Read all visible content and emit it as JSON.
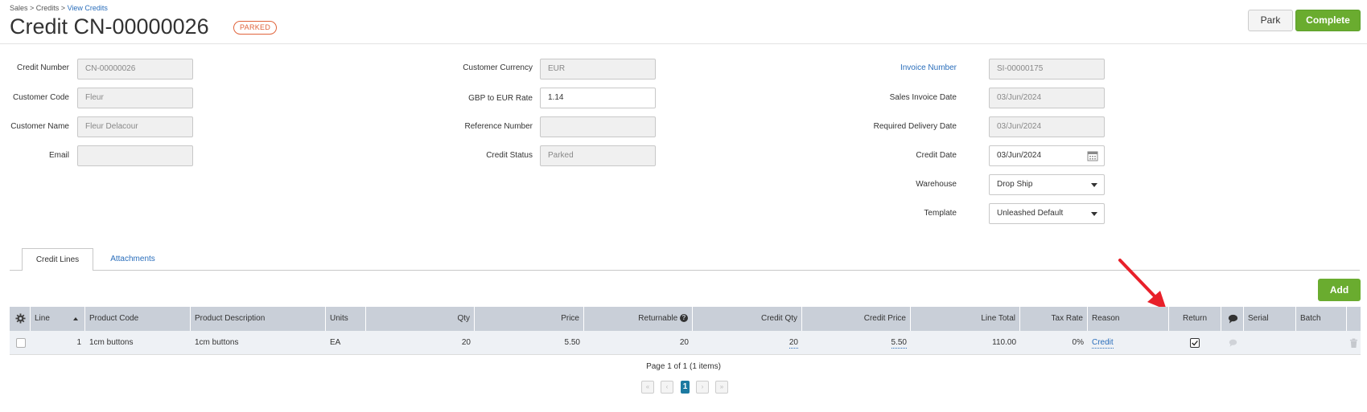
{
  "breadcrumb": {
    "part1": "Sales",
    "sep1": " > ",
    "part2": "Credits",
    "sep2": " > ",
    "part3": "View Credits"
  },
  "header": {
    "title": "Credit CN-00000026",
    "status_badge": "PARKED",
    "park_label": "Park",
    "complete_label": "Complete"
  },
  "form": {
    "credit_number": {
      "label": "Credit Number",
      "value": "CN-00000026"
    },
    "customer_code": {
      "label": "Customer Code",
      "value": "Fleur"
    },
    "customer_name": {
      "label": "Customer Name",
      "value": "Fleur Delacour"
    },
    "email": {
      "label": "Email",
      "value": ""
    },
    "customer_currency": {
      "label": "Customer Currency",
      "value": "EUR"
    },
    "exchange_rate": {
      "label": "GBP to EUR Rate",
      "value": "1.14"
    },
    "reference_number": {
      "label": "Reference Number",
      "value": ""
    },
    "credit_status": {
      "label": "Credit Status",
      "value": "Parked"
    },
    "invoice_number": {
      "label": "Invoice Number",
      "value": "SI-00000175"
    },
    "sales_invoice_date": {
      "label": "Sales Invoice Date",
      "value": "03/Jun/2024"
    },
    "required_delivery_date": {
      "label": "Required Delivery Date",
      "value": "03/Jun/2024"
    },
    "credit_date": {
      "label": "Credit Date",
      "value": "03/Jun/2024"
    },
    "warehouse": {
      "label": "Warehouse",
      "value": "Drop Ship"
    },
    "template": {
      "label": "Template",
      "value": "Unleashed Default"
    }
  },
  "tabs": [
    {
      "label": "Credit Lines"
    },
    {
      "label": "Attachments"
    }
  ],
  "add_label": "Add",
  "table": {
    "headers": {
      "line": "Line",
      "product_code": "Product Code",
      "product_description": "Product Description",
      "units": "Units",
      "qty": "Qty",
      "price": "Price",
      "returnable": "Returnable",
      "credit_qty": "Credit Qty",
      "credit_price": "Credit Price",
      "line_total": "Line Total",
      "tax_rate": "Tax Rate",
      "reason": "Reason",
      "return": "Return",
      "serial": "Serial",
      "batch": "Batch"
    },
    "rows": [
      {
        "line": "1",
        "product_code": "1cm buttons",
        "product_description": "1cm buttons",
        "units": "EA",
        "qty": "20",
        "price": "5.50",
        "returnable": "20",
        "credit_qty": "20",
        "credit_price": "5.50",
        "line_total": "110.00",
        "tax_rate": "0%",
        "reason": "Credit",
        "return_checked": true,
        "serial": "",
        "batch": ""
      }
    ]
  },
  "pager": {
    "summary": "Page 1 of 1 (1 items)",
    "current_page": "1"
  },
  "colors": {
    "accent_green": "#6aac2f",
    "link_blue": "#2a6ebb",
    "badge_orange": "#e0643c",
    "annotation_red": "#e8202a"
  }
}
